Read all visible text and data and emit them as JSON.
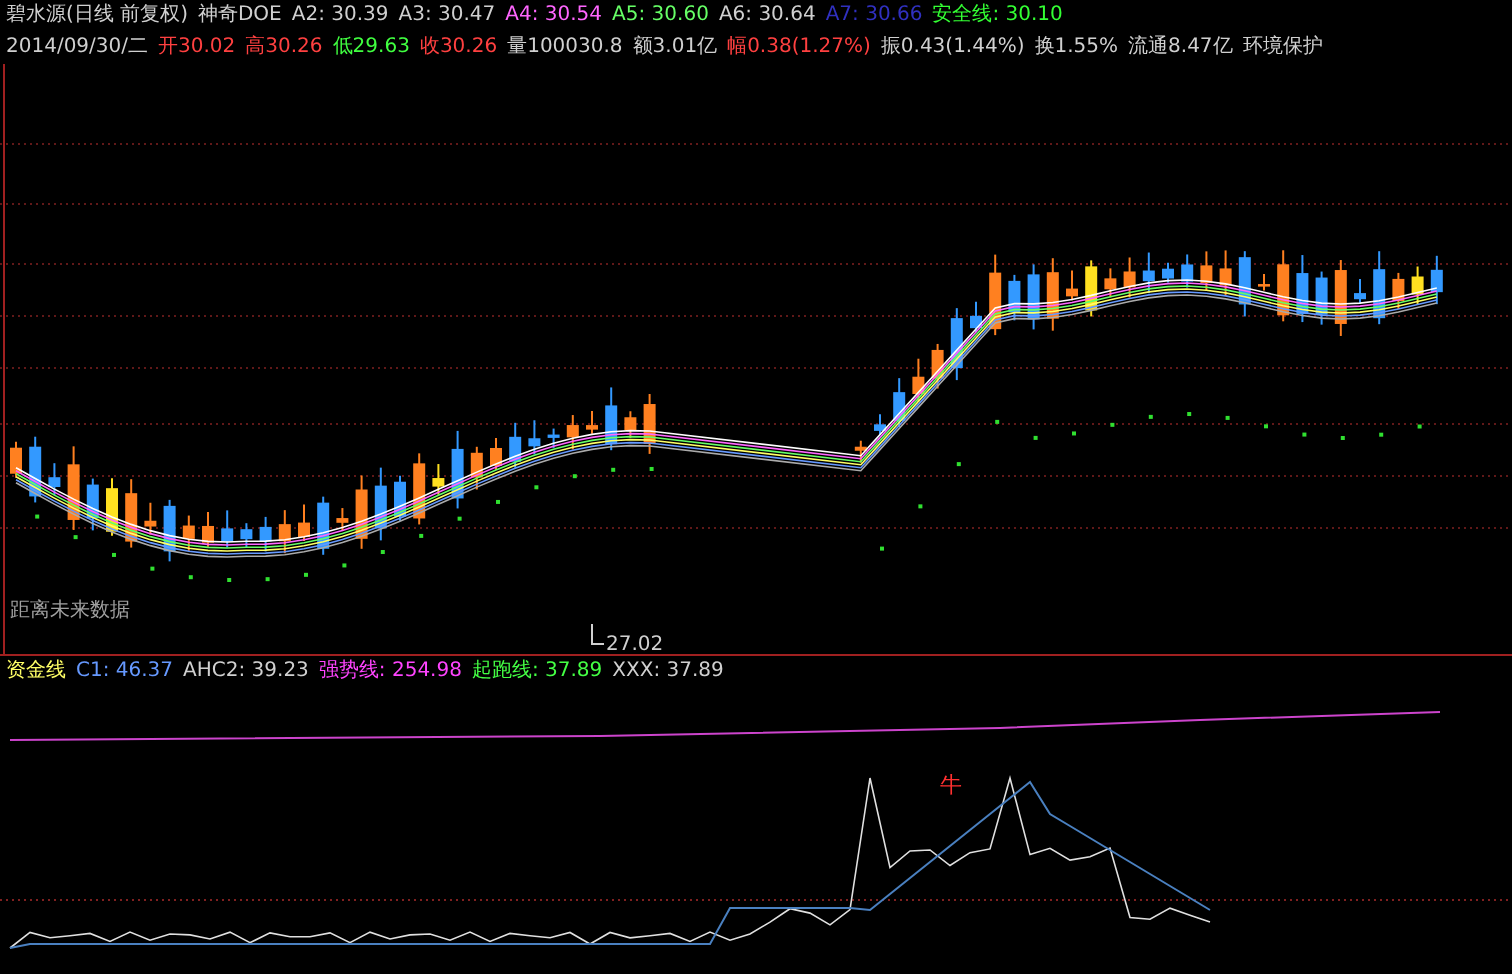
{
  "header": {
    "title": "碧水源(日线 前复权)",
    "indicator": "神奇DOE",
    "values": [
      {
        "text": "A2: 30.39",
        "color": "#d0d0d0"
      },
      {
        "text": "A3: 30.47",
        "color": "#d0d0d0"
      },
      {
        "text": "A4: 30.54",
        "color": "#ff66ff"
      },
      {
        "text": "A5: 30.60",
        "color": "#66ff66"
      },
      {
        "text": "A6: 30.64",
        "color": "#d0d0d0"
      },
      {
        "text": "A7: 30.66",
        "color": "#3030c0"
      },
      {
        "text": "安全线: 30.10",
        "color": "#33ff33"
      }
    ]
  },
  "quote": [
    {
      "text": "2014/09/30/二",
      "color": "#d0d0d0"
    },
    {
      "text": "开30.02",
      "color": "#ff4040"
    },
    {
      "text": "高30.26",
      "color": "#ff4040"
    },
    {
      "text": "低29.63",
      "color": "#40ff40"
    },
    {
      "text": "收30.26",
      "color": "#ff4040"
    },
    {
      "text": "量100030.8",
      "color": "#d0d0d0"
    },
    {
      "text": "额3.01亿",
      "color": "#d0d0d0"
    },
    {
      "text": "幅0.38(1.27%)",
      "color": "#ff4040"
    },
    {
      "text": "振0.43(1.44%)",
      "color": "#d0d0d0"
    },
    {
      "text": "换1.55%",
      "color": "#d0d0d0"
    },
    {
      "text": "流通8.47亿",
      "color": "#d0d0d0"
    },
    {
      "text": "环境保护",
      "color": "#d0d0d0"
    }
  ],
  "price_chart": {
    "low_label": "27.02",
    "note": "距离未来数据"
  },
  "indicator_header": [
    {
      "text": "资金线",
      "color": "#ffff66"
    },
    {
      "text": "C1: 46.37",
      "color": "#6699ff"
    },
    {
      "text": "AHC2: 39.23",
      "color": "#d0d0d0"
    },
    {
      "text": "强势线: 254.98",
      "color": "#ff44ff"
    },
    {
      "text": "起跑线: 37.89",
      "color": "#44ff44"
    },
    {
      "text": "XXX: 37.89",
      "color": "#d0d0d0"
    }
  ],
  "indicator_chart": {
    "mark": "牛"
  }
}
